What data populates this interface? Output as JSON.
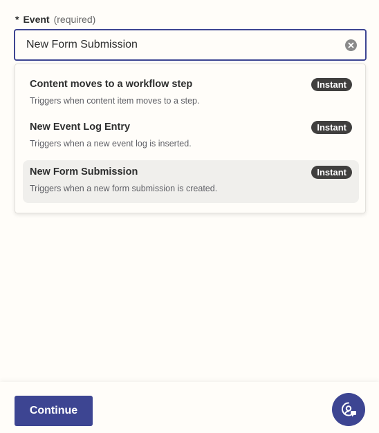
{
  "field": {
    "required_marker": "*",
    "label": "Event",
    "hint": "(required)",
    "value": "New Form Submission"
  },
  "options": [
    {
      "title": "Content moves to a workflow step",
      "description": "Triggers when content item moves to a step.",
      "badge": "Instant",
      "selected": false
    },
    {
      "title": "New Event Log Entry",
      "description": "Triggers when a new event log is inserted.",
      "badge": "Instant",
      "selected": false
    },
    {
      "title": "New Form Submission",
      "description": "Triggers when a new form submission is created.",
      "badge": "Instant",
      "selected": true
    }
  ],
  "footer": {
    "continue_label": "Continue"
  },
  "icons": {
    "clear": "clear-icon",
    "help": "support-chat-icon"
  },
  "colors": {
    "accent": "#3d4592",
    "badge_bg": "#403f3e",
    "selected_row_bg": "#f0efec",
    "page_bg": "#fffdf9"
  }
}
